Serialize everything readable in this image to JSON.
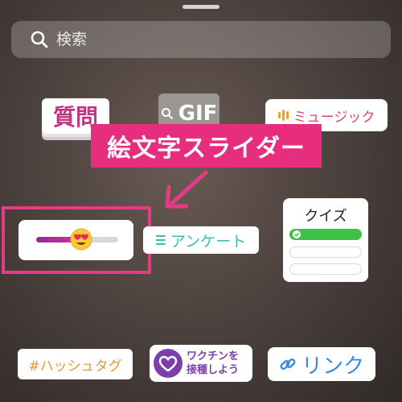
{
  "search": {
    "placeholder": "検索"
  },
  "stickers": {
    "question": "質問",
    "gif": "GIF",
    "music": "ミュージック",
    "poll": "アンケート",
    "quiz": "クイズ",
    "hashtag": "#ハッシュタグ",
    "vaccine_line1": "ワクチンを",
    "vaccine_line2": "接種しよう",
    "link": "リンク"
  },
  "emoji_slider": {
    "value": 0.55
  },
  "annotation": {
    "callout": "絵文字スライダー"
  },
  "colors": {
    "accent": "#e72e7e",
    "slider_start": "#8e2b8f",
    "slider_end": "#e0309a"
  }
}
